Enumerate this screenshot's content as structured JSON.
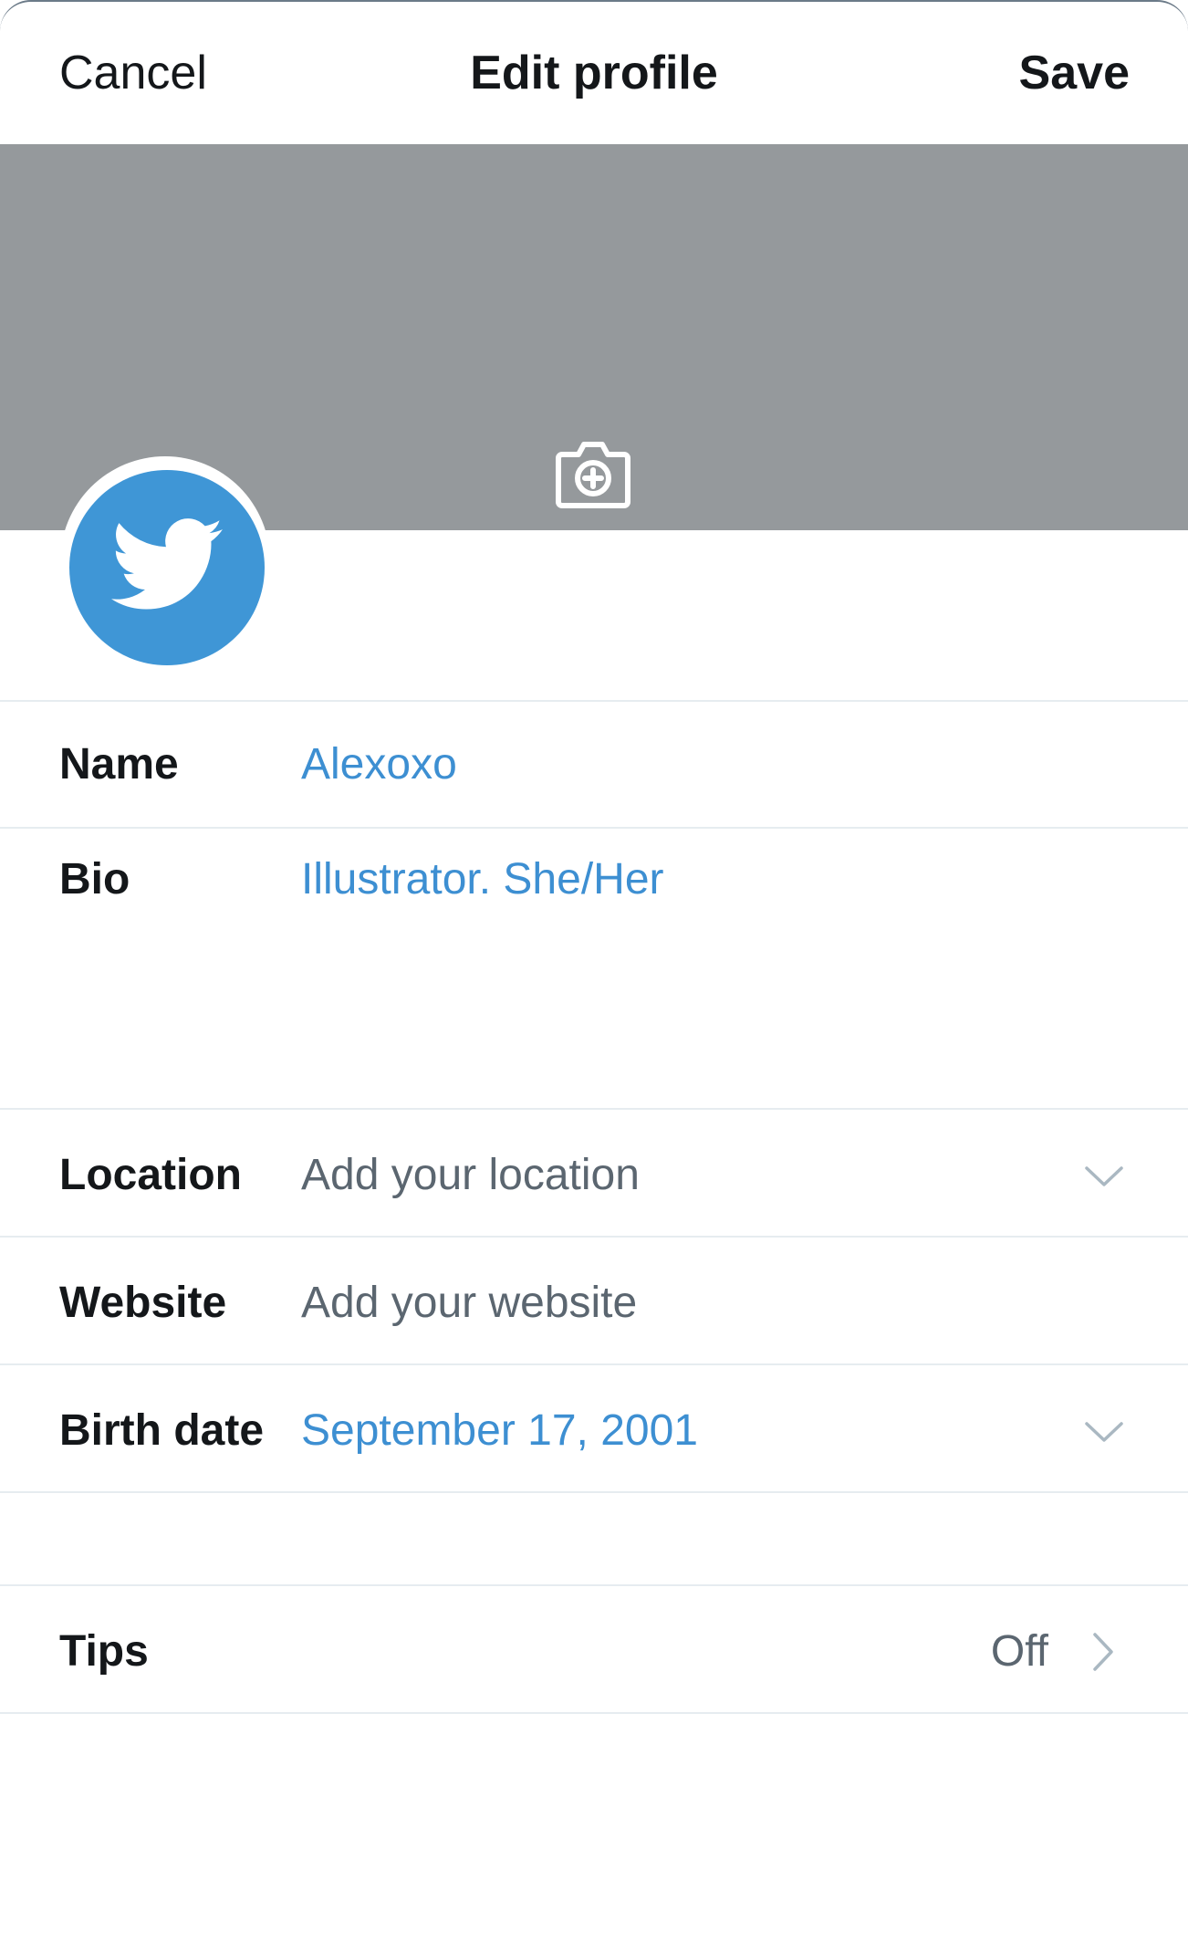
{
  "header": {
    "cancel_label": "Cancel",
    "title": "Edit profile",
    "save_label": "Save"
  },
  "banner": {
    "color": "#95999c",
    "icon": "camera-add-icon"
  },
  "avatar": {
    "color": "#3f96d6",
    "icon": "twitter-bird-icon"
  },
  "fields": {
    "name": {
      "label": "Name",
      "value": "Alexoxo"
    },
    "bio": {
      "label": "Bio",
      "value": "Illustrator. She/Her"
    },
    "location": {
      "label": "Location",
      "placeholder": "Add your location",
      "icon": "chevron-down-icon"
    },
    "website": {
      "label": "Website",
      "placeholder": "Add your website"
    },
    "birth_date": {
      "label": "Birth date",
      "value": "September 17, 2001",
      "icon": "chevron-down-icon"
    }
  },
  "tips": {
    "label": "Tips",
    "value": "Off",
    "icon": "chevron-right-icon"
  },
  "colors": {
    "accent": "#3d8fd2",
    "text": "#14171a",
    "secondary_text": "#5b6670",
    "divider": "#e6ecf0"
  }
}
